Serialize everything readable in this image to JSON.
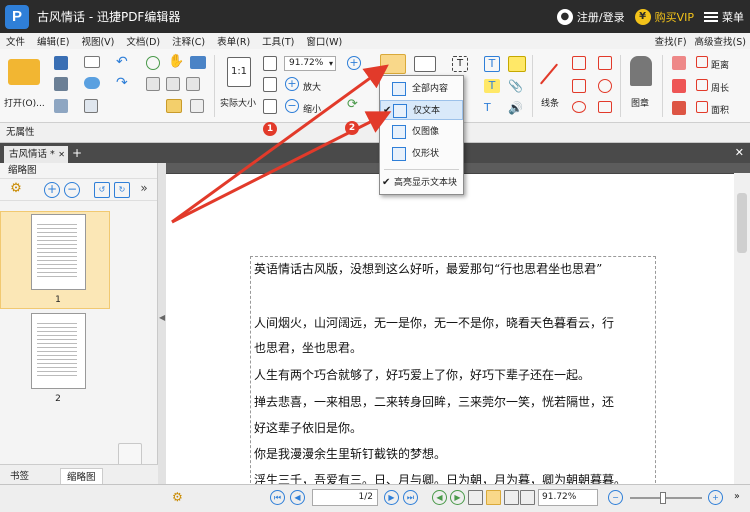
{
  "app": {
    "title": "古风情话 - 迅捷PDF编辑器",
    "logo_letter": "P",
    "login_label": "注册/登录",
    "vip_label": "购买VIP",
    "menu_label": "菜单"
  },
  "menubar": {
    "items": [
      "文件",
      "编辑(E)",
      "视图(V)",
      "文档(D)",
      "注释(C)",
      "表单(R)",
      "工具(T)",
      "窗口(W)"
    ],
    "find_label": "查找(F)",
    "advanced_find_label": "高级查找(S)"
  },
  "ribbon": {
    "open_label": "打开(O)...",
    "actual_size_label": "实际大小",
    "zoom_value": "91.72%",
    "zoom_in_label": "放大",
    "zoom_out_label": "缩小",
    "line_label": "线条",
    "stamp_label": "图章",
    "distance_label": "距离",
    "perimeter_label": "周长",
    "area_label": "面积"
  },
  "propbar": {
    "label": "无属性"
  },
  "tabs": {
    "doc_tab": "古风情话 *"
  },
  "leftpanel": {
    "header": "缩略图",
    "pages": [
      "1",
      "2"
    ],
    "bookmark_tab": "书签",
    "thumb_tab": "缩略图"
  },
  "dropdown": {
    "items": [
      "全部内容",
      "仅文本",
      "仅图像",
      "仅形状"
    ],
    "selected": "仅文本",
    "highlight_label": "高亮显示文本块"
  },
  "annotations": {
    "step1": "1",
    "step2": "2"
  },
  "document": {
    "lines": [
      "英语情话古风版，没想到这么好听，最爱那句“行也思君坐也思君”",
      "人间烟火，山河阔远，无一是你，无一不是你，晓看天色暮看云，行",
      "也思君，坐也思君。",
      "人生有两个巧合就够了，好巧爱上了你，好巧下辈子还在一起。",
      "掸去悲喜，一来相思，二来转身回眸，三来莞尔一笑，恍若隔世，还",
      "好这辈子依旧是你。",
      "你是我漫漫余生里斩钉截铁的梦想。",
      "浮生三千，吾爱有三。日、月与卿。日为朝，月为暮，卿为朝朝暮暮。"
    ]
  },
  "statusbar": {
    "page_value": "1",
    "page_total": "/2",
    "zoom_value": "91.72%"
  },
  "colors": {
    "accent": "#2f7fd8",
    "arrow_red": "#e23a2a",
    "vip_gold": "#f3c31a"
  }
}
